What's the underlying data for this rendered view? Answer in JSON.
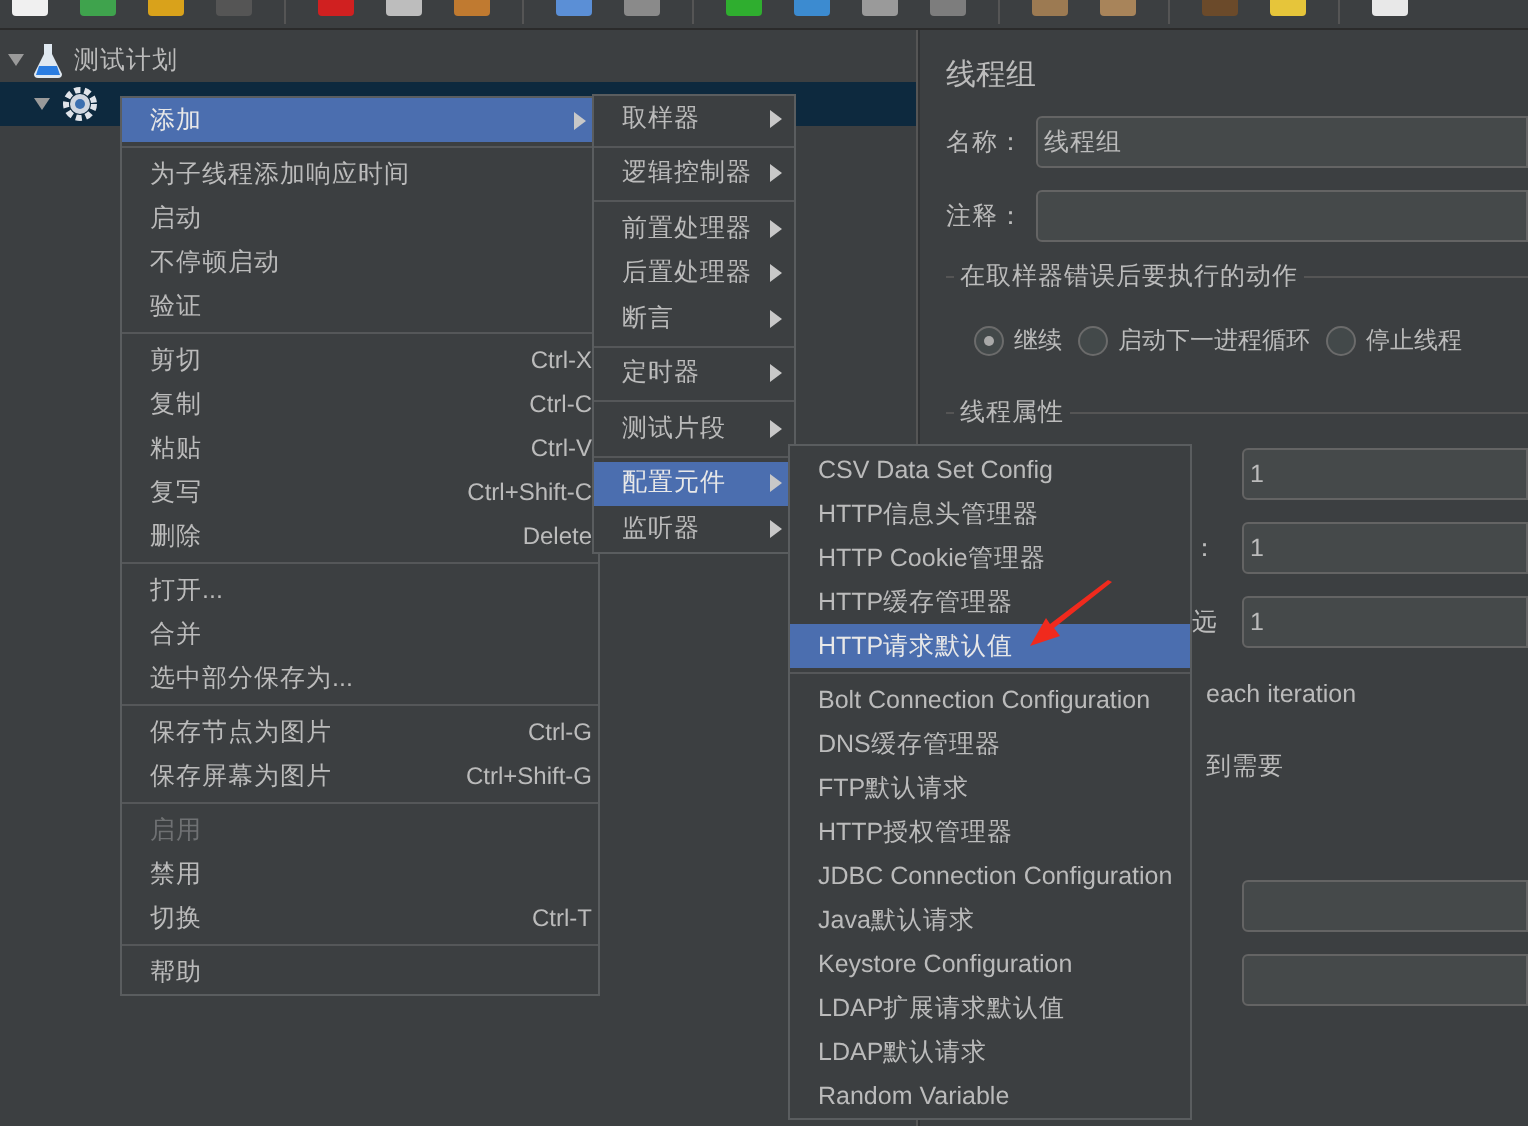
{
  "tree": [
    {
      "label": "测试计划",
      "expanded": true,
      "selected": false,
      "children": [
        {
          "selected": true,
          "expanded": true
        }
      ]
    }
  ],
  "panel": {
    "title": "线程组",
    "name_label": "名称：",
    "name_value": "线程组",
    "comment_label": "注释：",
    "error_action": {
      "title": "在取样器错误后要执行的动作",
      "options": [
        {
          "label": "继续",
          "selected": true
        },
        {
          "label": "启动下一进程循环",
          "selected": false
        },
        {
          "label": "停止线程",
          "selected": false
        }
      ]
    },
    "thread_props": {
      "title": "线程属性",
      "fields": [
        {
          "value": "1"
        },
        {
          "label": "：",
          "value": "1"
        },
        {
          "label": "远",
          "value": "1"
        }
      ],
      "notes": [
        "each iteration",
        "到需要"
      ],
      "extra_fields": [
        {
          "kind": "field"
        },
        {
          "kind": "field"
        }
      ]
    }
  },
  "context_menu": {
    "groups": [
      [
        {
          "label": "添加",
          "submenu": true,
          "selected": true,
          "disabled": false
        }
      ],
      [
        {
          "label": "为子线程添加响应时间",
          "submenu": false,
          "selected": false,
          "disabled": false
        },
        {
          "label": "启动",
          "submenu": false,
          "selected": false,
          "disabled": false
        },
        {
          "label": "不停顿启动",
          "submenu": false,
          "selected": false,
          "disabled": false
        },
        {
          "label": "验证",
          "submenu": false,
          "selected": false,
          "disabled": false
        }
      ],
      [
        {
          "label": "剪切",
          "shortcut": "Ctrl-X",
          "submenu": false,
          "selected": false,
          "disabled": false
        },
        {
          "label": "复制",
          "shortcut": "Ctrl-C",
          "submenu": false,
          "selected": false,
          "disabled": false
        },
        {
          "label": "粘贴",
          "shortcut": "Ctrl-V",
          "submenu": false,
          "selected": false,
          "disabled": false
        },
        {
          "label": "复写",
          "shortcut": "Ctrl+Shift-C",
          "submenu": false,
          "selected": false,
          "disabled": false
        },
        {
          "label": "删除",
          "shortcut": "Delete",
          "submenu": false,
          "selected": false,
          "disabled": false
        }
      ],
      [
        {
          "label": "打开...",
          "submenu": false,
          "selected": false,
          "disabled": false
        },
        {
          "label": "合并",
          "submenu": false,
          "selected": false,
          "disabled": false
        },
        {
          "label": "选中部分保存为...",
          "submenu": false,
          "selected": false,
          "disabled": false
        }
      ],
      [
        {
          "label": "保存节点为图片",
          "shortcut": "Ctrl-G",
          "submenu": false,
          "selected": false,
          "disabled": false
        },
        {
          "label": "保存屏幕为图片",
          "shortcut": "Ctrl+Shift-G",
          "submenu": false,
          "selected": false,
          "disabled": false
        }
      ],
      [
        {
          "label": "启用",
          "submenu": false,
          "selected": false,
          "disabled": true
        },
        {
          "label": "禁用",
          "submenu": false,
          "selected": false,
          "disabled": false
        },
        {
          "label": "切换",
          "shortcut": "Ctrl-T",
          "submenu": false,
          "selected": false,
          "disabled": false
        }
      ],
      [
        {
          "label": "帮助",
          "submenu": false,
          "selected": false,
          "disabled": false
        }
      ]
    ]
  },
  "add_submenu": {
    "groups": [
      [
        {
          "label": "取样器",
          "submenu": true,
          "selected": false,
          "disabled": false
        }
      ],
      [
        {
          "label": "逻辑控制器",
          "submenu": true,
          "selected": false,
          "disabled": false
        }
      ],
      [
        {
          "label": "前置处理器",
          "submenu": true,
          "selected": false,
          "disabled": false
        },
        {
          "label": "后置处理器",
          "submenu": true,
          "selected": false,
          "disabled": false
        },
        {
          "label": "断言",
          "submenu": true,
          "selected": false,
          "disabled": false
        }
      ],
      [
        {
          "label": "定时器",
          "submenu": true,
          "selected": false,
          "disabled": false
        }
      ],
      [
        {
          "label": "测试片段",
          "submenu": true,
          "selected": false,
          "disabled": false
        }
      ],
      [
        {
          "label": "配置元件",
          "submenu": true,
          "selected": true,
          "disabled": false
        },
        {
          "label": "监听器",
          "submenu": true,
          "selected": false,
          "disabled": false
        }
      ]
    ]
  },
  "config_submenu": {
    "groups": [
      [
        {
          "label": "CSV Data Set Config",
          "submenu": false,
          "selected": false,
          "disabled": false
        },
        {
          "label": "HTTP信息头管理器",
          "submenu": false,
          "selected": false,
          "disabled": false
        },
        {
          "label": "HTTP Cookie管理器",
          "submenu": false,
          "selected": false,
          "disabled": false
        },
        {
          "label": "HTTP缓存管理器",
          "submenu": false,
          "selected": false,
          "disabled": false
        },
        {
          "label": "HTTP请求默认值",
          "submenu": false,
          "selected": true,
          "disabled": false
        }
      ],
      [
        {
          "label": "Bolt Connection Configuration",
          "submenu": false,
          "selected": false,
          "disabled": false
        },
        {
          "label": "DNS缓存管理器",
          "submenu": false,
          "selected": false,
          "disabled": false
        },
        {
          "label": "FTP默认请求",
          "submenu": false,
          "selected": false,
          "disabled": false
        },
        {
          "label": "HTTP授权管理器",
          "submenu": false,
          "selected": false,
          "disabled": false
        },
        {
          "label": "JDBC Connection Configuration",
          "submenu": false,
          "selected": false,
          "disabled": false
        },
        {
          "label": "Java默认请求",
          "submenu": false,
          "selected": false,
          "disabled": false
        },
        {
          "label": "Keystore Configuration",
          "submenu": false,
          "selected": false,
          "disabled": false
        },
        {
          "label": "LDAP扩展请求默认值",
          "submenu": false,
          "selected": false,
          "disabled": false
        },
        {
          "label": "LDAP默认请求",
          "submenu": false,
          "selected": false,
          "disabled": false
        },
        {
          "label": "Random Variable",
          "submenu": false,
          "selected": false,
          "disabled": false
        }
      ]
    ]
  }
}
